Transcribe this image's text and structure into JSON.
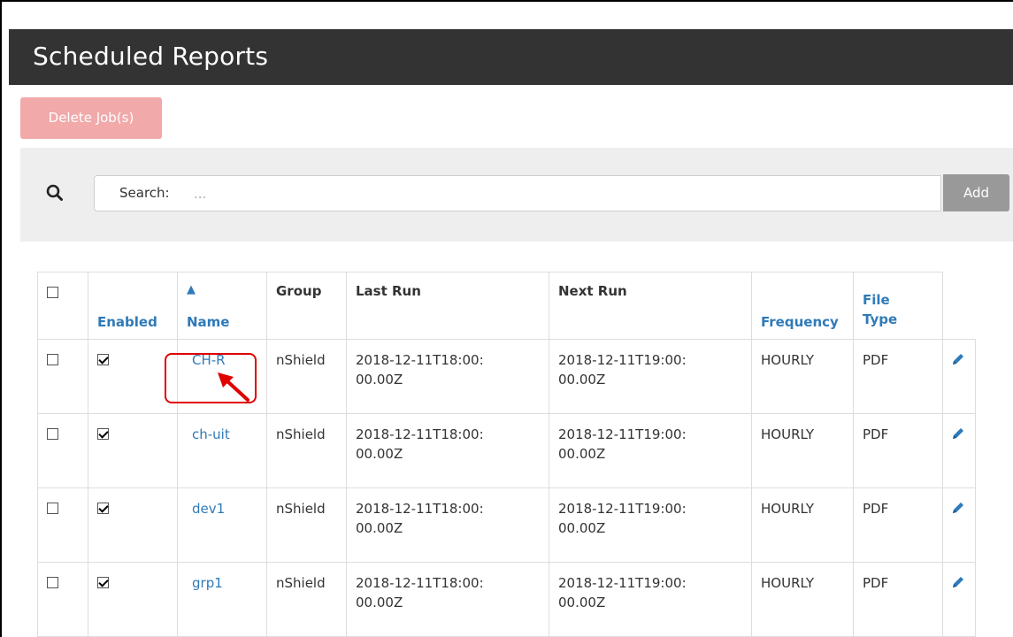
{
  "header": {
    "title": "Scheduled Reports"
  },
  "toolbar": {
    "delete_label": "Delete Job(s)"
  },
  "search": {
    "label": "Search:",
    "placeholder": "...",
    "value": "",
    "add_label": "Add"
  },
  "table": {
    "columns": {
      "enabled": "Enabled",
      "sort_arrow": "▲",
      "name": "Name",
      "group": "Group",
      "last_run": "Last Run",
      "next_run": "Next Run",
      "frequency": "Frequency",
      "file_type": "File Type"
    },
    "rows": [
      {
        "enabled": true,
        "name": "CH-R",
        "group": "nShield",
        "last_run": "2018-12-11T18:00:00.00Z",
        "next_run": "2018-12-11T19:00:00.00Z",
        "frequency": "HOURLY",
        "file_type": "PDF"
      },
      {
        "enabled": true,
        "name": "ch-uit",
        "group": "nShield",
        "last_run": "2018-12-11T18:00:00.00Z",
        "next_run": "2018-12-11T19:00:00.00Z",
        "frequency": "HOURLY",
        "file_type": "PDF"
      },
      {
        "enabled": true,
        "name": "dev1",
        "group": "nShield",
        "last_run": "2018-12-11T18:00:00.00Z",
        "next_run": "2018-12-11T19:00:00.00Z",
        "frequency": "HOURLY",
        "file_type": "PDF"
      },
      {
        "enabled": true,
        "name": "grp1",
        "group": "nShield",
        "last_run": "2018-12-11T18:00:00.00Z",
        "next_run": "2018-12-11T19:00:00.00Z",
        "frequency": "HOURLY",
        "file_type": "PDF"
      }
    ]
  },
  "colors": {
    "header_bg": "#333333",
    "link": "#2f7ab8",
    "delete_bg": "#f1a9a9",
    "add_bg": "#999999",
    "panel_bg": "#eeeeee",
    "highlight": "#e00000"
  },
  "icons": {
    "search": "magnifier-icon",
    "edit": "pencil-icon",
    "annotation": "red-arrow-icon"
  }
}
